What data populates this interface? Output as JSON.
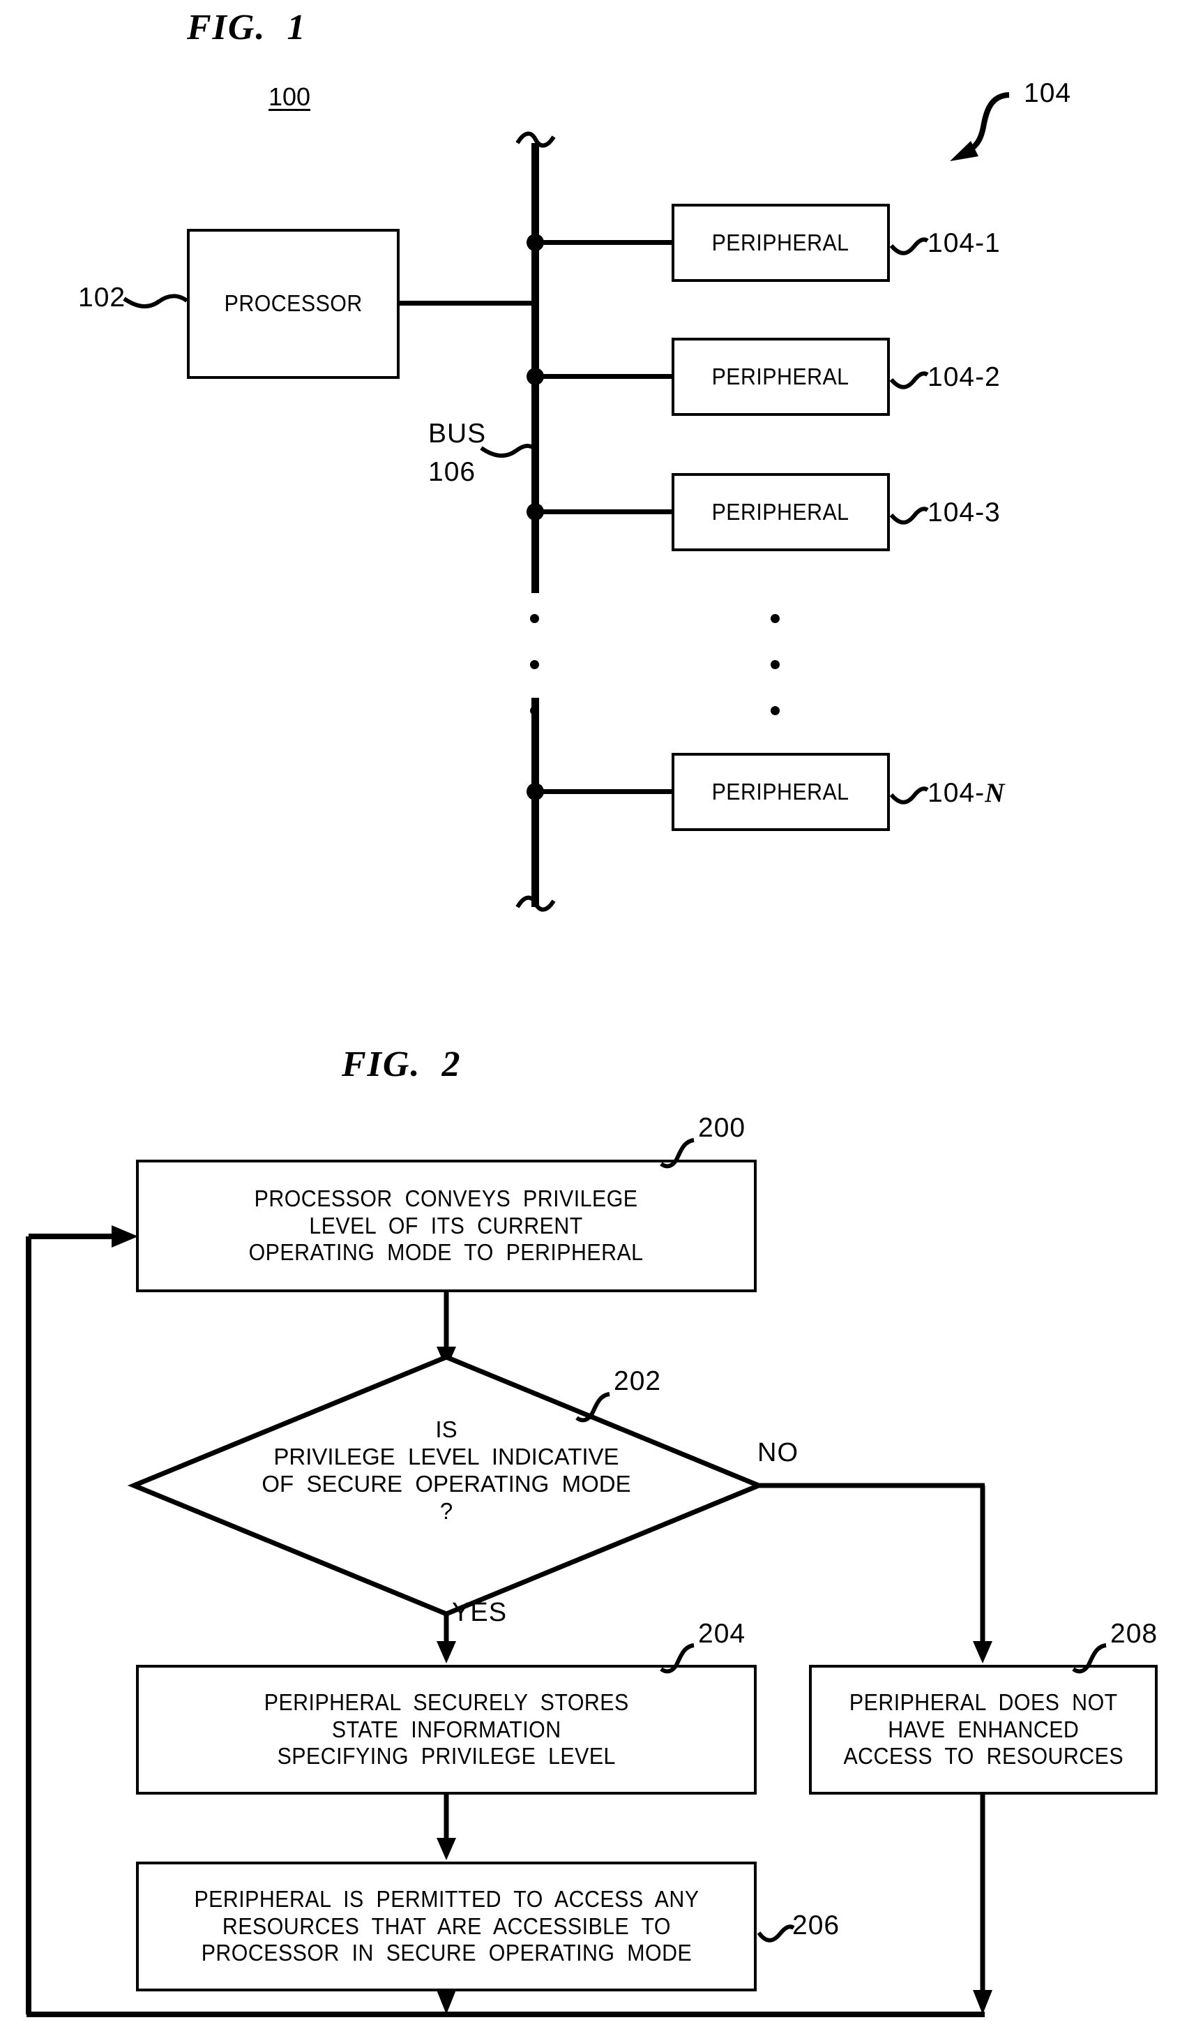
{
  "figures": [
    {
      "title": "FIG.  1",
      "number": "100",
      "processor": {
        "label": "PROCESSOR",
        "ref": "102"
      },
      "bus": {
        "label_line1": "BUS",
        "label_line2": "106",
        "ref": "106"
      },
      "peripheral_group_ref": "104",
      "peripherals": [
        {
          "label": "PERIPHERAL",
          "ref": "104-1"
        },
        {
          "label": "PERIPHERAL",
          "ref": "104-2"
        },
        {
          "label": "PERIPHERAL",
          "ref": "104-3"
        },
        {
          "label": "PERIPHERAL",
          "ref": "104-",
          "ref_italic": "N"
        }
      ],
      "ellipsis": "vertical-three-dots"
    },
    {
      "title": "FIG.  2",
      "nodes": [
        {
          "id": "200",
          "shape": "process",
          "ref": "200",
          "lines": [
            "PROCESSOR  CONVEYS  PRIVILEGE",
            "LEVEL  OF  ITS  CURRENT",
            "OPERATING  MODE  TO  PERIPHERAL"
          ]
        },
        {
          "id": "202",
          "shape": "decision",
          "ref": "202",
          "lines": [
            "IS",
            "PRIVILEGE  LEVEL  INDICATIVE",
            "OF  SECURE  OPERATING  MODE",
            "?"
          ]
        },
        {
          "id": "204",
          "shape": "process",
          "ref": "204",
          "lines": [
            "PERIPHERAL  SECURELY  STORES",
            "STATE  INFORMATION",
            "SPECIFYING  PRIVILEGE  LEVEL"
          ]
        },
        {
          "id": "206",
          "shape": "process",
          "ref": "206",
          "lines": [
            "PERIPHERAL  IS  PERMITTED  TO  ACCESS  ANY",
            "RESOURCES  THAT  ARE  ACCESSIBLE  TO",
            "PROCESSOR  IN  SECURE  OPERATING  MODE"
          ]
        },
        {
          "id": "208",
          "shape": "process",
          "ref": "208",
          "lines": [
            "PERIPHERAL  DOES  NOT",
            "HAVE  ENHANCED",
            "ACCESS  TO  RESOURCES"
          ]
        }
      ],
      "edge_labels": {
        "yes": "YES",
        "no": "NO"
      }
    }
  ],
  "colors": {
    "ink": "#000000",
    "paper": "#ffffff"
  }
}
